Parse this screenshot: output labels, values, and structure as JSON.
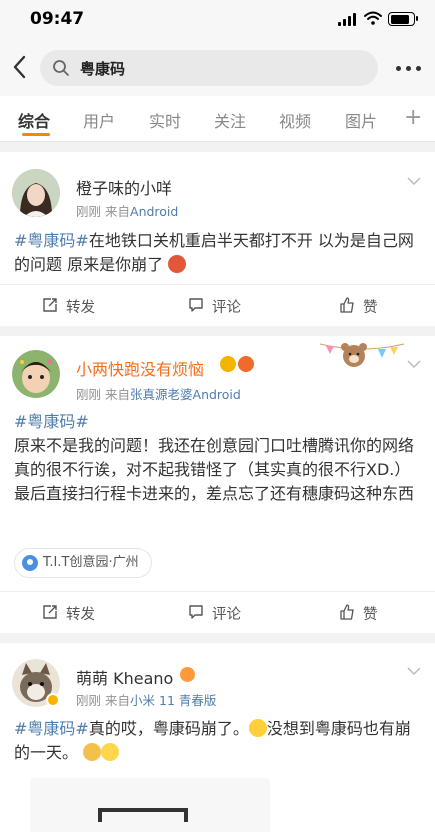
{
  "status_bar": {
    "time": "09:47"
  },
  "search": {
    "query": "粤康码"
  },
  "tabs": [
    {
      "label": "综合"
    },
    {
      "label": "用户"
    },
    {
      "label": "实时"
    },
    {
      "label": "关注"
    },
    {
      "label": "视频"
    },
    {
      "label": "图片"
    }
  ],
  "tabs_add": "+",
  "posts": [
    {
      "user": "橙子味的小咩",
      "time": "刚刚",
      "source_prefix": "来自",
      "source": "Android",
      "hashtag": "#粤康码#",
      "text": "在地铁口关机重启半天都打不开 以为是自己网的问题 原来是你崩了",
      "actions": {
        "repost": "转发",
        "comment": "评论",
        "like": "赞"
      }
    },
    {
      "user": "小两快跑没有烦恼",
      "time": "刚刚",
      "source_prefix": "来自",
      "source": "张真源老婆Android",
      "hashtag": "#粤康码#",
      "text": "原来不是我的问题！我还在创意园门口吐槽腾讯你的网络真的很不行诶，对不起我错怪了（其实真的很不行XD.）最后直接扫行程卡进来的，差点忘了还有穗康码这种东西",
      "location": "T.I.T创意园·广州",
      "actions": {
        "repost": "转发",
        "comment": "评论",
        "like": "赞"
      }
    },
    {
      "user": "萌萌 Kheano",
      "time": "刚刚",
      "source_prefix": "来自",
      "source": "小米 11 青春版",
      "hashtag": "#粤康码#",
      "text": "真的哎，粤康码崩了。",
      "text2": "没想到粤康码也有崩的一天。"
    }
  ],
  "colors": {
    "accent": "#ff8200",
    "link": "#507daf",
    "vip_name": "#f86d19"
  }
}
